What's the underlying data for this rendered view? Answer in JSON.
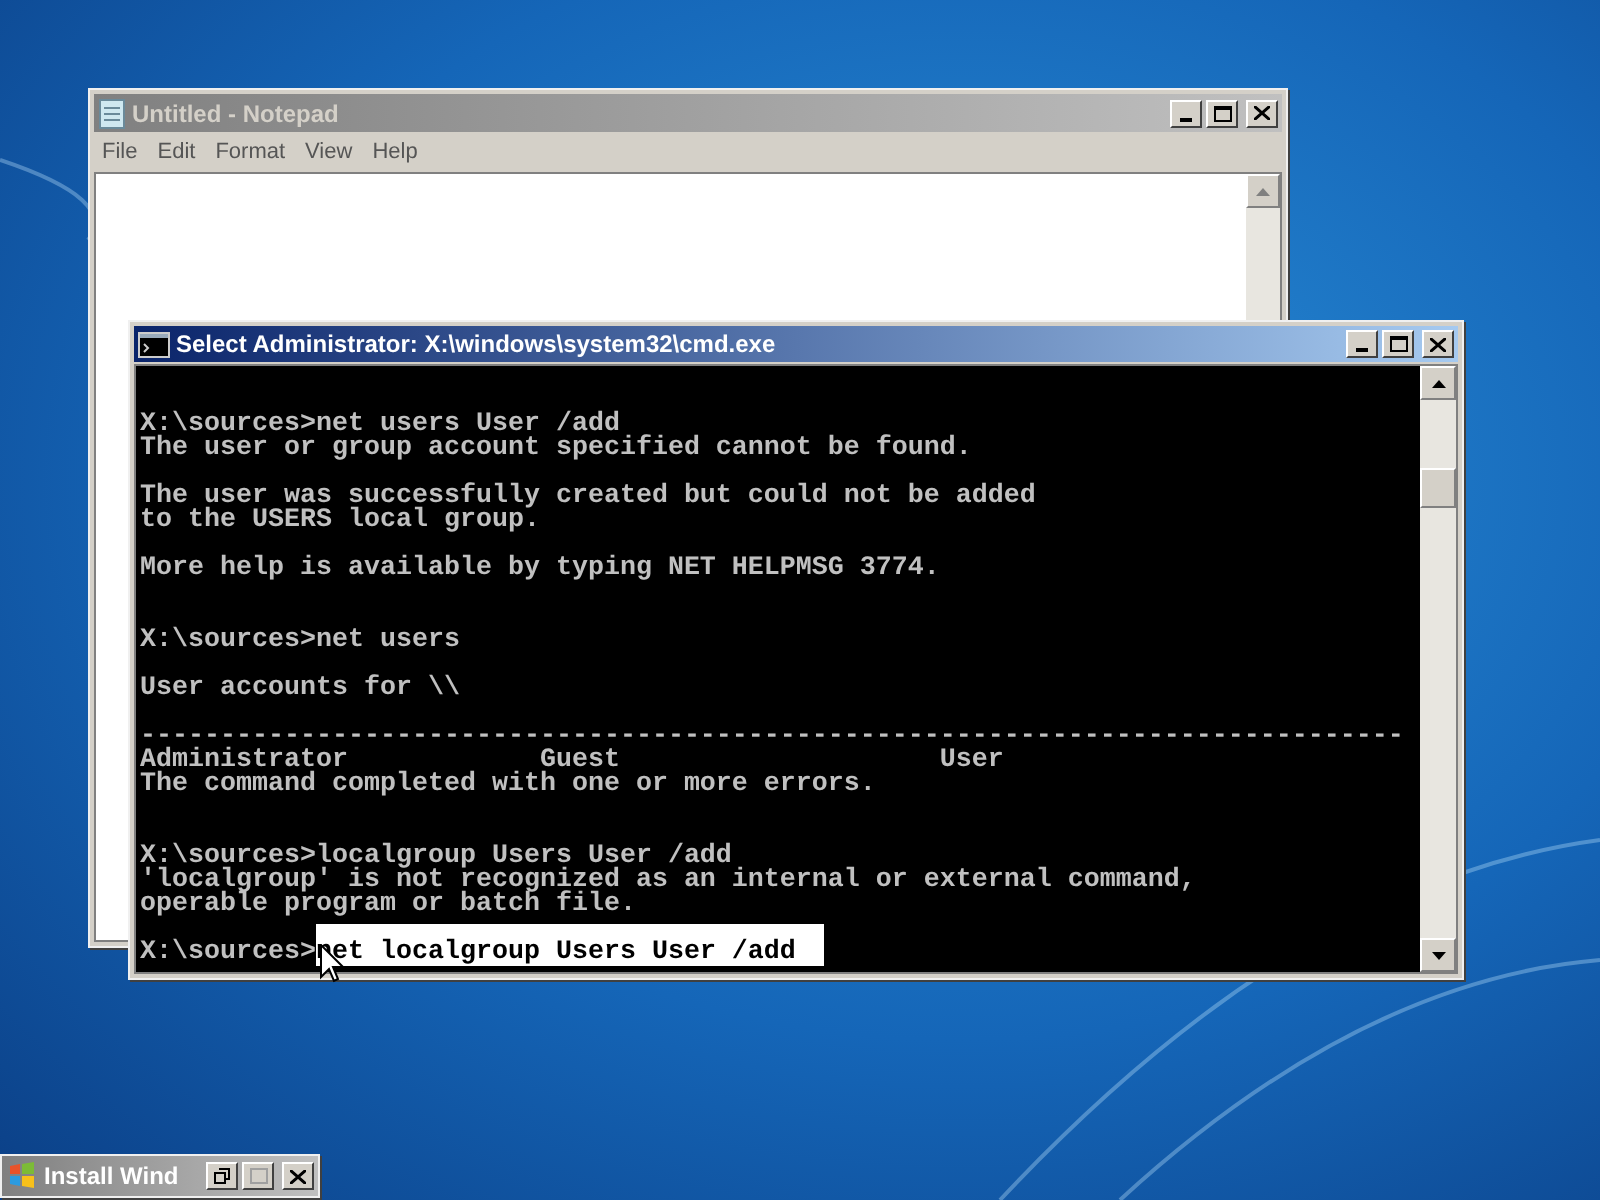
{
  "notepad": {
    "title": "Untitled - Notepad",
    "active": false,
    "menu": [
      "File",
      "Edit",
      "Format",
      "View",
      "Help"
    ]
  },
  "cmd": {
    "title": "Select Administrator: X:\\windows\\system32\\cmd.exe",
    "active": true,
    "lines": [
      {
        "kind": "blank"
      },
      {
        "kind": "blank"
      },
      {
        "kind": "text",
        "text": "X:\\sources>net users User /add"
      },
      {
        "kind": "text",
        "text": "The user or group account specified cannot be found."
      },
      {
        "kind": "blank"
      },
      {
        "kind": "text",
        "text": "The user was successfully created but could not be added"
      },
      {
        "kind": "text",
        "text": "to the USERS local group."
      },
      {
        "kind": "blank"
      },
      {
        "kind": "text",
        "text": "More help is available by typing NET HELPMSG 3774."
      },
      {
        "kind": "blank"
      },
      {
        "kind": "blank"
      },
      {
        "kind": "text",
        "text": "X:\\sources>net users"
      },
      {
        "kind": "blank"
      },
      {
        "kind": "text",
        "text": "User accounts for \\\\"
      },
      {
        "kind": "blank"
      },
      {
        "kind": "text",
        "text": "-------------------------------------------------------------------------------"
      },
      {
        "kind": "text",
        "text": "Administrator            Guest                    User"
      },
      {
        "kind": "text",
        "text": "The command completed with one or more errors."
      },
      {
        "kind": "blank"
      },
      {
        "kind": "blank"
      },
      {
        "kind": "text",
        "text": "X:\\sources>localgroup Users User /add"
      },
      {
        "kind": "text",
        "text": "'localgroup' is not recognized as an internal or external command,"
      },
      {
        "kind": "text",
        "text": "operable program or batch file."
      },
      {
        "kind": "blank"
      },
      {
        "kind": "prompt",
        "prompt": "X:\\sources>",
        "selection": "net localgroup Users User /add"
      }
    ]
  },
  "minimized": {
    "title": "Install Wind",
    "active": false
  }
}
